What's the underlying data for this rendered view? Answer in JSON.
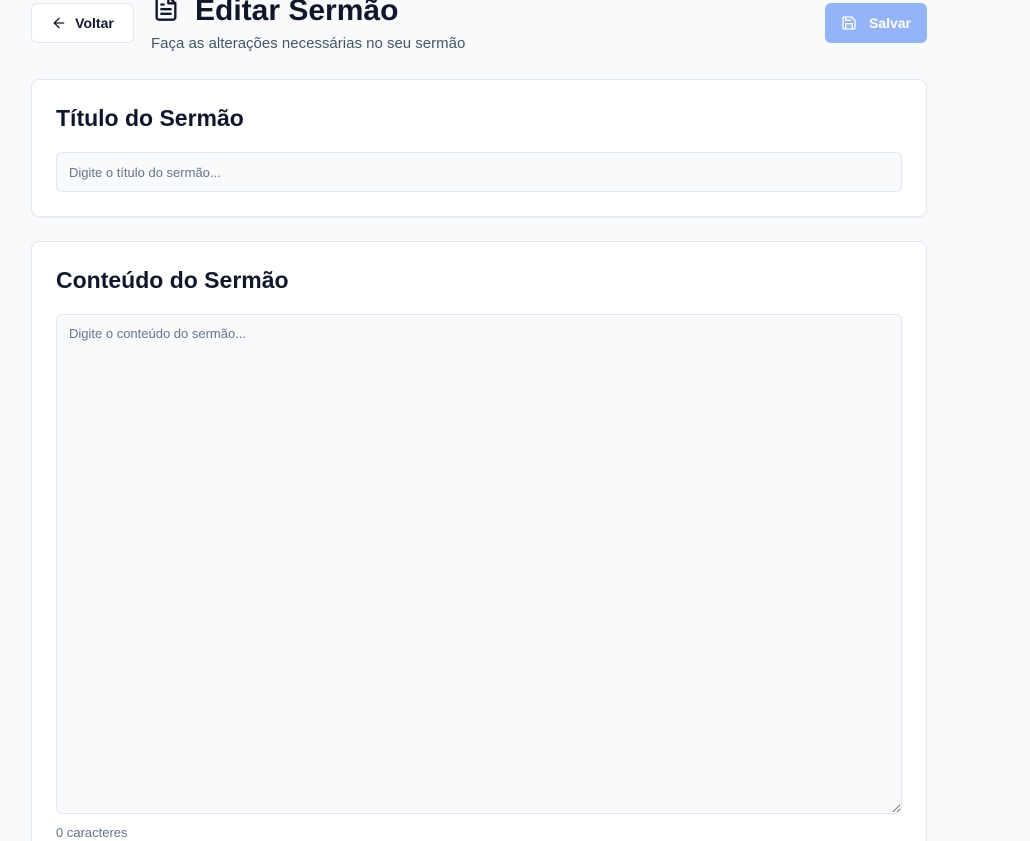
{
  "header": {
    "back_label": "Voltar",
    "title": "Editar Sermão",
    "subtitle": "Faça as alterações necessárias no seu sermão",
    "save_label": "Salvar",
    "title_icon": "file-text-icon"
  },
  "title_card": {
    "heading": "Título do Sermão",
    "input_placeholder": "Digite o título do sermão...",
    "input_value": ""
  },
  "content_card": {
    "heading": "Conteúdo do Sermão",
    "textarea_placeholder": "Digite o conteúdo do sermão...",
    "textarea_value": "",
    "char_count": "0 caracteres"
  },
  "colors": {
    "background": "#f8fafc",
    "save_button_disabled": "#93b4f6",
    "text_primary": "#0f172a",
    "text_muted": "#64748b"
  }
}
